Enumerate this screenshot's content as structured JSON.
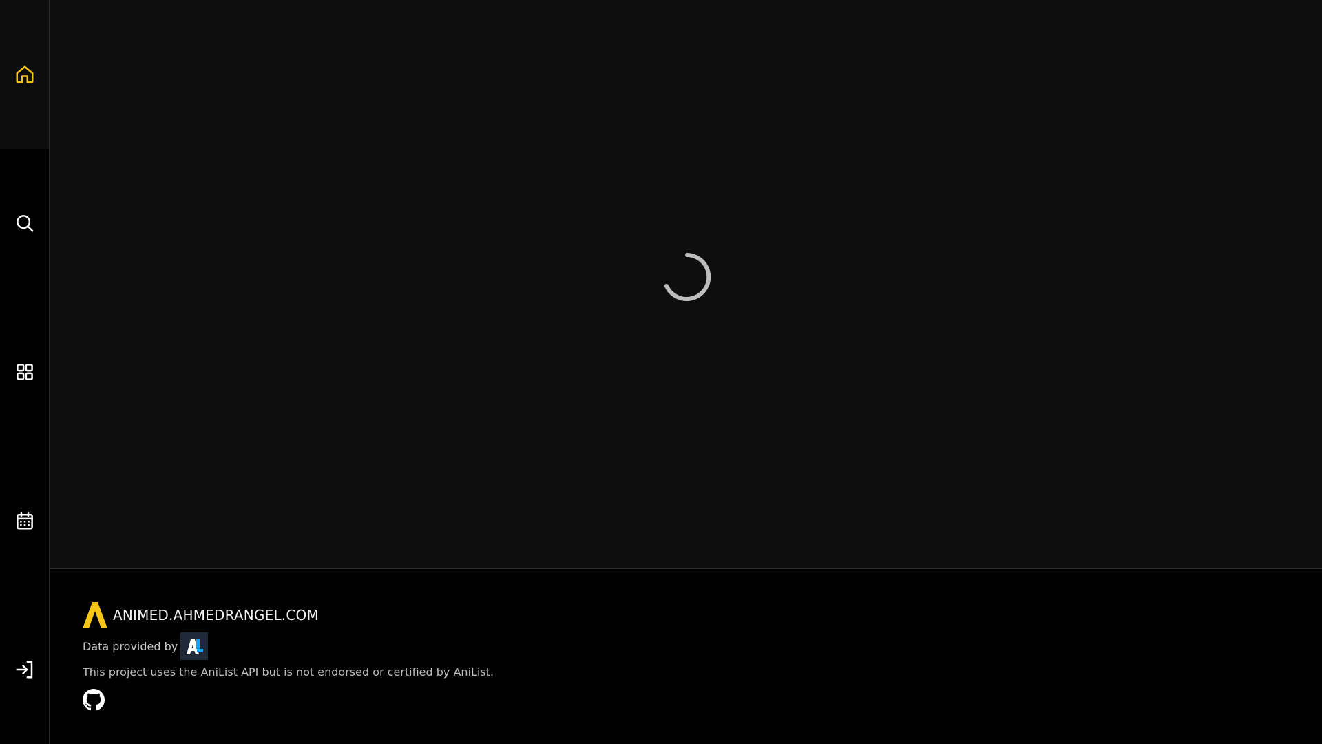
{
  "sidebar": {
    "items": [
      {
        "icon": "home-icon",
        "active": true
      },
      {
        "icon": "search-icon",
        "active": false
      },
      {
        "icon": "grid-icon",
        "active": false
      },
      {
        "icon": "calendar-icon",
        "active": false
      },
      {
        "icon": "login-icon",
        "active": false
      }
    ]
  },
  "main": {
    "state": "loading"
  },
  "footer": {
    "brand_name": "ANIMED.AHMEDRANGEL.COM",
    "data_provided_label": "Data provided by",
    "disclaimer": "This project uses the AniList API but is not endorsed or certified by AniList.",
    "github_icon": "github-icon"
  },
  "colors": {
    "accent": "#f5c518",
    "anilist_blue": "#02a9ff",
    "background": "#0e0e0f",
    "footer_bg": "#000000",
    "icon_white": "#ffffff"
  }
}
